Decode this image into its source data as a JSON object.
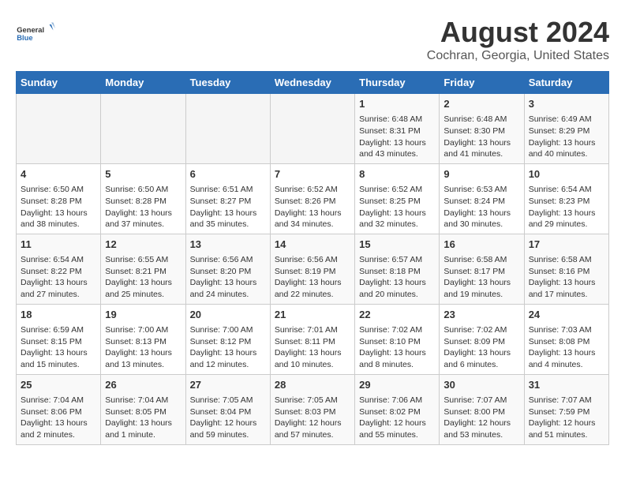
{
  "header": {
    "logo_general": "General",
    "logo_blue": "Blue",
    "main_title": "August 2024",
    "subtitle": "Cochran, Georgia, United States"
  },
  "weekdays": [
    "Sunday",
    "Monday",
    "Tuesday",
    "Wednesday",
    "Thursday",
    "Friday",
    "Saturday"
  ],
  "weeks": [
    [
      {
        "day": "",
        "sunrise": "",
        "sunset": "",
        "daylight": ""
      },
      {
        "day": "",
        "sunrise": "",
        "sunset": "",
        "daylight": ""
      },
      {
        "day": "",
        "sunrise": "",
        "sunset": "",
        "daylight": ""
      },
      {
        "day": "",
        "sunrise": "",
        "sunset": "",
        "daylight": ""
      },
      {
        "day": "1",
        "sunrise": "Sunrise: 6:48 AM",
        "sunset": "Sunset: 8:31 PM",
        "daylight": "Daylight: 13 hours and 43 minutes."
      },
      {
        "day": "2",
        "sunrise": "Sunrise: 6:48 AM",
        "sunset": "Sunset: 8:30 PM",
        "daylight": "Daylight: 13 hours and 41 minutes."
      },
      {
        "day": "3",
        "sunrise": "Sunrise: 6:49 AM",
        "sunset": "Sunset: 8:29 PM",
        "daylight": "Daylight: 13 hours and 40 minutes."
      }
    ],
    [
      {
        "day": "4",
        "sunrise": "Sunrise: 6:50 AM",
        "sunset": "Sunset: 8:28 PM",
        "daylight": "Daylight: 13 hours and 38 minutes."
      },
      {
        "day": "5",
        "sunrise": "Sunrise: 6:50 AM",
        "sunset": "Sunset: 8:28 PM",
        "daylight": "Daylight: 13 hours and 37 minutes."
      },
      {
        "day": "6",
        "sunrise": "Sunrise: 6:51 AM",
        "sunset": "Sunset: 8:27 PM",
        "daylight": "Daylight: 13 hours and 35 minutes."
      },
      {
        "day": "7",
        "sunrise": "Sunrise: 6:52 AM",
        "sunset": "Sunset: 8:26 PM",
        "daylight": "Daylight: 13 hours and 34 minutes."
      },
      {
        "day": "8",
        "sunrise": "Sunrise: 6:52 AM",
        "sunset": "Sunset: 8:25 PM",
        "daylight": "Daylight: 13 hours and 32 minutes."
      },
      {
        "day": "9",
        "sunrise": "Sunrise: 6:53 AM",
        "sunset": "Sunset: 8:24 PM",
        "daylight": "Daylight: 13 hours and 30 minutes."
      },
      {
        "day": "10",
        "sunrise": "Sunrise: 6:54 AM",
        "sunset": "Sunset: 8:23 PM",
        "daylight": "Daylight: 13 hours and 29 minutes."
      }
    ],
    [
      {
        "day": "11",
        "sunrise": "Sunrise: 6:54 AM",
        "sunset": "Sunset: 8:22 PM",
        "daylight": "Daylight: 13 hours and 27 minutes."
      },
      {
        "day": "12",
        "sunrise": "Sunrise: 6:55 AM",
        "sunset": "Sunset: 8:21 PM",
        "daylight": "Daylight: 13 hours and 25 minutes."
      },
      {
        "day": "13",
        "sunrise": "Sunrise: 6:56 AM",
        "sunset": "Sunset: 8:20 PM",
        "daylight": "Daylight: 13 hours and 24 minutes."
      },
      {
        "day": "14",
        "sunrise": "Sunrise: 6:56 AM",
        "sunset": "Sunset: 8:19 PM",
        "daylight": "Daylight: 13 hours and 22 minutes."
      },
      {
        "day": "15",
        "sunrise": "Sunrise: 6:57 AM",
        "sunset": "Sunset: 8:18 PM",
        "daylight": "Daylight: 13 hours and 20 minutes."
      },
      {
        "day": "16",
        "sunrise": "Sunrise: 6:58 AM",
        "sunset": "Sunset: 8:17 PM",
        "daylight": "Daylight: 13 hours and 19 minutes."
      },
      {
        "day": "17",
        "sunrise": "Sunrise: 6:58 AM",
        "sunset": "Sunset: 8:16 PM",
        "daylight": "Daylight: 13 hours and 17 minutes."
      }
    ],
    [
      {
        "day": "18",
        "sunrise": "Sunrise: 6:59 AM",
        "sunset": "Sunset: 8:15 PM",
        "daylight": "Daylight: 13 hours and 15 minutes."
      },
      {
        "day": "19",
        "sunrise": "Sunrise: 7:00 AM",
        "sunset": "Sunset: 8:13 PM",
        "daylight": "Daylight: 13 hours and 13 minutes."
      },
      {
        "day": "20",
        "sunrise": "Sunrise: 7:00 AM",
        "sunset": "Sunset: 8:12 PM",
        "daylight": "Daylight: 13 hours and 12 minutes."
      },
      {
        "day": "21",
        "sunrise": "Sunrise: 7:01 AM",
        "sunset": "Sunset: 8:11 PM",
        "daylight": "Daylight: 13 hours and 10 minutes."
      },
      {
        "day": "22",
        "sunrise": "Sunrise: 7:02 AM",
        "sunset": "Sunset: 8:10 PM",
        "daylight": "Daylight: 13 hours and 8 minutes."
      },
      {
        "day": "23",
        "sunrise": "Sunrise: 7:02 AM",
        "sunset": "Sunset: 8:09 PM",
        "daylight": "Daylight: 13 hours and 6 minutes."
      },
      {
        "day": "24",
        "sunrise": "Sunrise: 7:03 AM",
        "sunset": "Sunset: 8:08 PM",
        "daylight": "Daylight: 13 hours and 4 minutes."
      }
    ],
    [
      {
        "day": "25",
        "sunrise": "Sunrise: 7:04 AM",
        "sunset": "Sunset: 8:06 PM",
        "daylight": "Daylight: 13 hours and 2 minutes."
      },
      {
        "day": "26",
        "sunrise": "Sunrise: 7:04 AM",
        "sunset": "Sunset: 8:05 PM",
        "daylight": "Daylight: 13 hours and 1 minute."
      },
      {
        "day": "27",
        "sunrise": "Sunrise: 7:05 AM",
        "sunset": "Sunset: 8:04 PM",
        "daylight": "Daylight: 12 hours and 59 minutes."
      },
      {
        "day": "28",
        "sunrise": "Sunrise: 7:05 AM",
        "sunset": "Sunset: 8:03 PM",
        "daylight": "Daylight: 12 hours and 57 minutes."
      },
      {
        "day": "29",
        "sunrise": "Sunrise: 7:06 AM",
        "sunset": "Sunset: 8:02 PM",
        "daylight": "Daylight: 12 hours and 55 minutes."
      },
      {
        "day": "30",
        "sunrise": "Sunrise: 7:07 AM",
        "sunset": "Sunset: 8:00 PM",
        "daylight": "Daylight: 12 hours and 53 minutes."
      },
      {
        "day": "31",
        "sunrise": "Sunrise: 7:07 AM",
        "sunset": "Sunset: 7:59 PM",
        "daylight": "Daylight: 12 hours and 51 minutes."
      }
    ]
  ]
}
